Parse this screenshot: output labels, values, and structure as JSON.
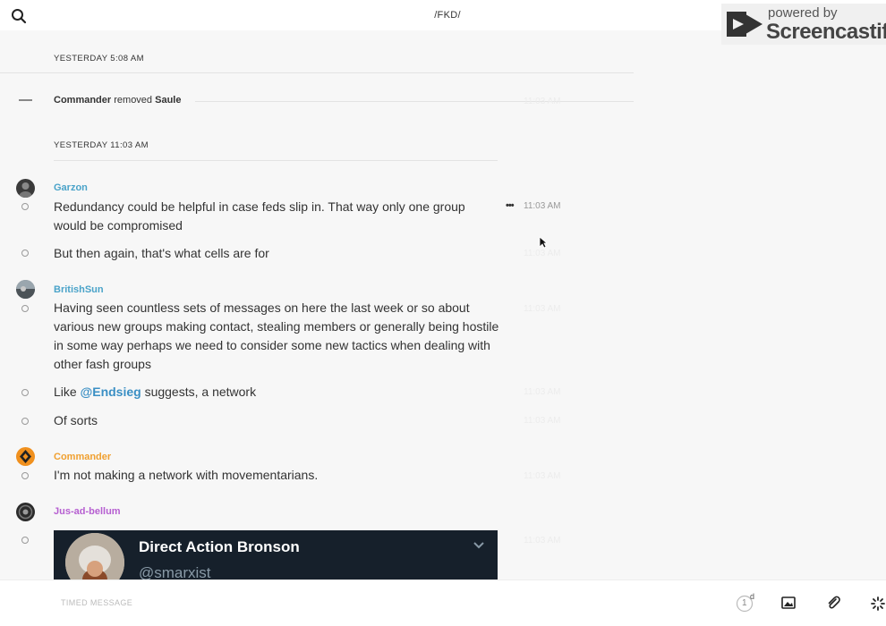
{
  "header": {
    "channel_title": "/FKD/",
    "watermark_small": "powered by",
    "watermark_big": "Screencastify"
  },
  "feed": {
    "date_1": "YESTERDAY 5:08 AM",
    "system_event": {
      "actor": "Commander",
      "verb": "removed",
      "target": "Saule"
    },
    "date_2": "YESTERDAY 11:03 AM",
    "groups": [
      {
        "author": "Garzon",
        "author_color": "#4aa3c9",
        "messages": [
          {
            "text": "Redundancy could be helpful in case feds slip in. That way only one group would be compromised",
            "time": "11:03 AM"
          },
          {
            "text": "But then again, that's what cells are for",
            "time": "11:03 AM"
          }
        ]
      },
      {
        "author": "BritishSun",
        "author_color": "#4aa3c9",
        "messages": [
          {
            "text": "Having seen countless sets of messages on here the last week or so about various new groups making contact, stealing members or generally being hostile in some way perhaps we need to consider some new tactics when dealing with other fash groups",
            "time": "11:03 AM"
          },
          {
            "prefix": "Like ",
            "mention": "@Endsieg",
            "suffix": " suggests, a network",
            "time": "11:03 AM"
          },
          {
            "text": "Of sorts",
            "time": "11:03 AM"
          }
        ]
      },
      {
        "author": "Commander",
        "author_color": "#f0a030",
        "messages": [
          {
            "text": "I'm not making a network with movementarians.",
            "time": "11:03 AM"
          }
        ]
      },
      {
        "author": "Jus-ad-bellum",
        "author_color": "#b65fd1",
        "messages": [
          {
            "time": "11:03 AM"
          }
        ]
      }
    ],
    "embed": {
      "title": "Direct Action Bronson",
      "handle": "@smarxist"
    }
  },
  "composer": {
    "placeholder": "TIMED MESSAGE",
    "timer_value": "1",
    "timer_unit": "d"
  },
  "icons": [
    "search-icon",
    "phone-icon",
    "info-icon",
    "more-options-icon",
    "timer-icon",
    "image-icon",
    "paperclip-icon",
    "loading-spinner-icon",
    "chevron-down-icon"
  ]
}
